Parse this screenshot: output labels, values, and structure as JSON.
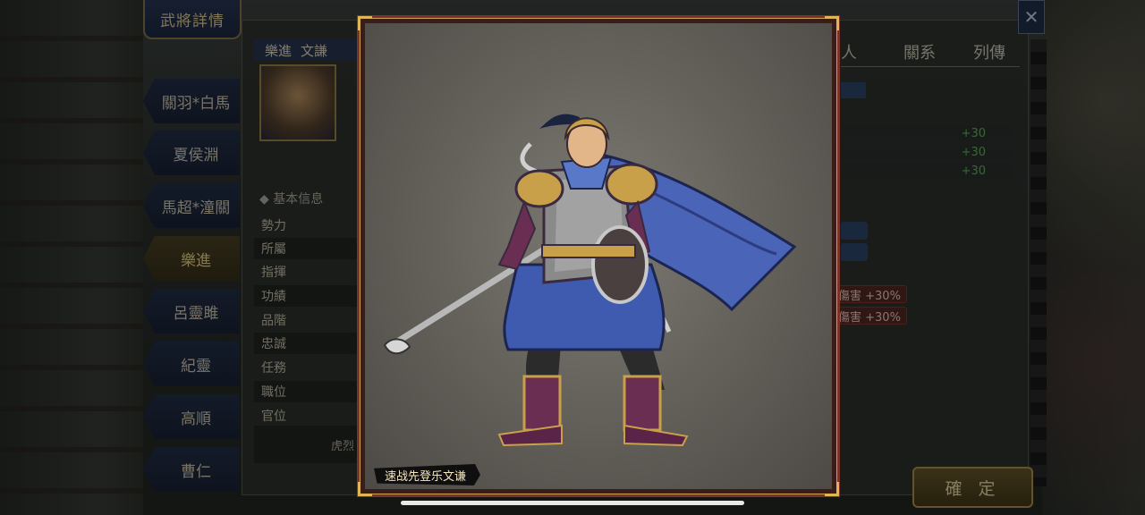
{
  "header": {
    "title": "武將詳情"
  },
  "sidebar": {
    "items": [
      {
        "label": "關羽*白馬"
      },
      {
        "label": "夏侯淵"
      },
      {
        "label": "馬超*潼關"
      },
      {
        "label": "樂進"
      },
      {
        "label": "呂靈雎"
      },
      {
        "label": "紀靈"
      },
      {
        "label": "高順"
      },
      {
        "label": "曹仁"
      }
    ]
  },
  "general": {
    "name": "樂進",
    "courtesy": "文謙"
  },
  "basic_info": {
    "header": "基本信息",
    "rows": [
      "勢力",
      "所屬",
      "指揮",
      "功績",
      "品階",
      "忠誠",
      "任務",
      "職位",
      "官位"
    ],
    "leader_label": "虎烈"
  },
  "right_tabs": [
    "人",
    "關系",
    "列傳"
  ],
  "stats": {
    "bonuses": [
      "+30",
      "+30",
      "+30"
    ],
    "damage": [
      "傷害 +30%",
      "傷害 +30%"
    ]
  },
  "buttons": {
    "confirm": "確 定",
    "close": "✕"
  },
  "modal": {
    "caption": "速战先登乐文谦"
  },
  "colors": {
    "frame": "#7a3326",
    "gold": "#e0b654",
    "cape": "#4a64b8"
  }
}
